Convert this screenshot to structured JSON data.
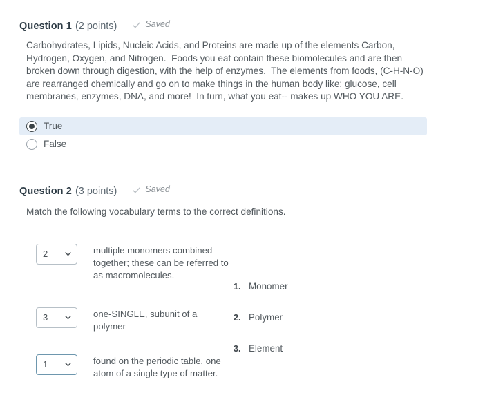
{
  "questions": [
    {
      "title": "Question 1",
      "points": "(2 points)",
      "saved_label": "Saved",
      "body": "Carbohydrates, Lipids, Nucleic Acids, and Proteins are made up of the elements Carbon, Hydrogen, Oxygen, and Nitrogen.  Foods you eat contain these biomolecules and are then broken down through digestion, with the help of enzymes.  The elements from foods, (C-H-N-O) are rearranged chemically and go on to make things in the human body like: glucose, cell membranes, enzymes, DNA, and more!  In turn, what you eat-- makes up WHO YOU ARE.",
      "answers": [
        {
          "label": "True",
          "selected": true
        },
        {
          "label": "False",
          "selected": false
        }
      ]
    },
    {
      "title": "Question 2",
      "points": "(3 points)",
      "saved_label": "Saved",
      "instruction": "Match the following vocabulary terms to the correct definitions.",
      "matches": [
        {
          "selected_value": "2",
          "definition": "multiple monomers combined together; these can be referred to as macromolecules.",
          "focused": false
        },
        {
          "selected_value": "3",
          "definition": "one-SINGLE, subunit of a polymer",
          "focused": false
        },
        {
          "selected_value": "1",
          "definition": "found on the periodic table, one atom of a single type of matter.",
          "focused": true
        }
      ],
      "terms": [
        {
          "number": "1.",
          "label": "Monomer"
        },
        {
          "number": "2.",
          "label": "Polymer"
        },
        {
          "number": "3.",
          "label": "Element"
        }
      ]
    }
  ],
  "colors": {
    "selected_answer_background": "#e4edf7",
    "title": "#2d3b45",
    "body_text": "#52595e",
    "saved_text": "#8b9196",
    "select_border": "#b7c0c7",
    "select_border_focused": "#6e97ae"
  }
}
